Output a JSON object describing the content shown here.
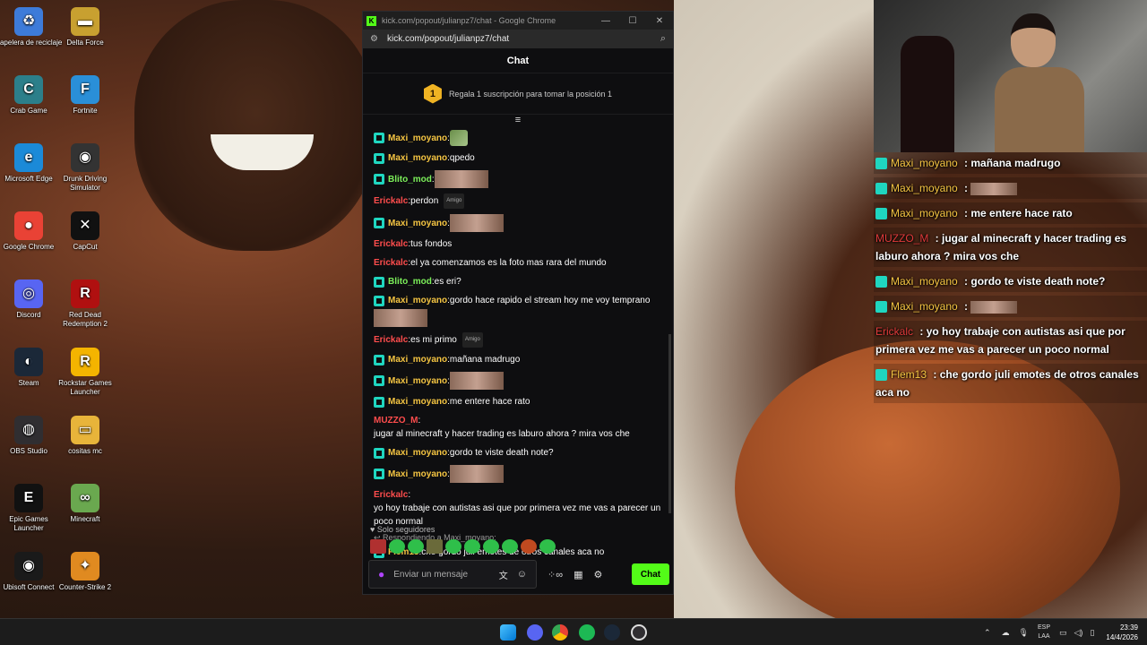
{
  "desktop": {
    "icons": [
      {
        "label": "Papelera de reciclaje",
        "glyph": "♻",
        "color": "#3d7bd9"
      },
      {
        "label": "Delta Force",
        "glyph": "▬",
        "color": "#c8a030"
      },
      {
        "label": "Crab Game",
        "glyph": "C",
        "color": "#2c7f8a"
      },
      {
        "label": "Fortnite",
        "glyph": "F",
        "color": "#2a8fd8"
      },
      {
        "label": "Microsoft Edge",
        "glyph": "e",
        "color": "#1b8ad8"
      },
      {
        "label": "Drunk Driving Simulator",
        "glyph": "◉",
        "color": "#333333"
      },
      {
        "label": "Google Chrome",
        "glyph": "●",
        "color": "#e94235"
      },
      {
        "label": "CapCut",
        "glyph": "✕",
        "color": "#111111"
      },
      {
        "label": "Discord",
        "glyph": "◎",
        "color": "#5865f2"
      },
      {
        "label": "Red Dead Redemption 2",
        "glyph": "R",
        "color": "#b01010"
      },
      {
        "label": "Steam",
        "glyph": "◐",
        "color": "#1b2838"
      },
      {
        "label": "Rockstar Games Launcher",
        "glyph": "R",
        "color": "#f4b400"
      },
      {
        "label": "OBS Studio",
        "glyph": "◍",
        "color": "#302e31"
      },
      {
        "label": "cositas mc",
        "glyph": "▭",
        "color": "#e8b43a"
      },
      {
        "label": "Epic Games Launcher",
        "glyph": "E",
        "color": "#111111"
      },
      {
        "label": "Minecraft",
        "glyph": "∞",
        "color": "#6aa84f"
      },
      {
        "label": "Ubisoft Connect",
        "glyph": "◉",
        "color": "#1a1a1a"
      },
      {
        "label": "Counter-Strike 2",
        "glyph": "✦",
        "color": "#e08a20"
      }
    ]
  },
  "window": {
    "title": "kick.com/popout/julianpz7/chat - Google Chrome",
    "url": "kick.com/popout/julianpz7/chat",
    "minimize": "—",
    "maximize": "☐",
    "close": "✕"
  },
  "chat": {
    "header": "Chat",
    "promo_rank": "1",
    "promo_text": "Regala 1 suscripción para tomar la posición 1",
    "pin_icon": "≡",
    "messages": [
      {
        "user": "Maxi_moyano",
        "color": "#f5c542",
        "badge": true,
        "text": "",
        "emote": "emote"
      },
      {
        "user": "Maxi_moyano",
        "color": "#f5c542",
        "badge": true,
        "text": "qpedo"
      },
      {
        "user": "Blito_mod",
        "color": "#7cf05a",
        "badge": true,
        "text": "",
        "emote": "image"
      },
      {
        "user": "Erickalc",
        "color": "#ff4d4d",
        "badge": false,
        "text": "perdon",
        "tag": "Amigo"
      },
      {
        "user": "Maxi_moyano",
        "color": "#f5c542",
        "badge": true,
        "text": "",
        "emote": "image"
      },
      {
        "user": "Erickalc",
        "color": "#ff4d4d",
        "badge": false,
        "text": "tus fondos"
      },
      {
        "user": "Erickalc",
        "color": "#ff4d4d",
        "badge": false,
        "text": "el ya comenzamos es la foto mas rara del mundo"
      },
      {
        "user": "Blito_mod",
        "color": "#7cf05a",
        "badge": true,
        "text": "es eri?"
      },
      {
        "user": "Maxi_moyano",
        "color": "#f5c542",
        "badge": true,
        "text": "gordo hace rapido el stream hoy me voy temprano",
        "emote": "image-below"
      },
      {
        "user": "Erickalc",
        "color": "#ff4d4d",
        "badge": false,
        "text": "es mi primo",
        "tag": "Amigo"
      },
      {
        "user": "Maxi_moyano",
        "color": "#f5c542",
        "badge": true,
        "text": "mañana madrugo"
      },
      {
        "user": "Maxi_moyano",
        "color": "#f5c542",
        "badge": true,
        "text": "",
        "emote": "image"
      },
      {
        "user": "Maxi_moyano",
        "color": "#f5c542",
        "badge": true,
        "text": "me entere hace rato"
      },
      {
        "user": "MUZZO_M",
        "color": "#ff4d4d",
        "badge": false,
        "text": "jugar al minecraft y hacer trading es laburo ahora ? mira vos che"
      },
      {
        "user": "Maxi_moyano",
        "color": "#f5c542",
        "badge": true,
        "text": "gordo te viste death note?"
      },
      {
        "user": "Maxi_moyano",
        "color": "#f5c542",
        "badge": true,
        "text": "",
        "emote": "image"
      },
      {
        "user": "Erickalc",
        "color": "#ff4d4d",
        "badge": false,
        "text": "yo hoy trabaje con autistas asi que por primera vez me vas a parecer un poco normal"
      },
      {
        "reply": "Respondiendo a Maxi_moyano:",
        "user": "Flem13",
        "color": "#f5c542",
        "badge": true,
        "text": "che gordo juli emotes de otros canales aca no"
      }
    ],
    "followers_only": "Solo seguidores",
    "input_placeholder": "Enviar un mensaje",
    "send_label": "Chat"
  },
  "overlay": {
    "rows": [
      {
        "user": "Maxi_moyano",
        "color": "#f5c542",
        "badge": true,
        "text": "mañana madrugo"
      },
      {
        "user": "Maxi_moyano",
        "color": "#f5c542",
        "badge": true,
        "text": "",
        "emote": true
      },
      {
        "user": "Maxi_moyano",
        "color": "#f5c542",
        "badge": true,
        "text": "me entere hace rato"
      },
      {
        "user": "MUZZO_M",
        "color": "#e03a3a",
        "badge": false,
        "text": "jugar al minecraft y hacer trading es laburo ahora ? mira vos che"
      },
      {
        "user": "Maxi_moyano",
        "color": "#f5c542",
        "badge": true,
        "text": "gordo te viste death note?"
      },
      {
        "user": "Maxi_moyano",
        "color": "#f5c542",
        "badge": true,
        "text": "",
        "emote": true
      },
      {
        "user": "Erickalc",
        "color": "#e03a3a",
        "badge": false,
        "text": "yo hoy trabaje con autistas asi que por primera vez me vas a parecer un poco normal"
      },
      {
        "user": "Flem13",
        "color": "#f5c542",
        "badge": true,
        "text": "che gordo juli emotes de otros canales aca no"
      }
    ]
  },
  "taskbar": {
    "language": "ESP",
    "region": "LAA",
    "time": "23:39",
    "date": "14/4/2026"
  }
}
